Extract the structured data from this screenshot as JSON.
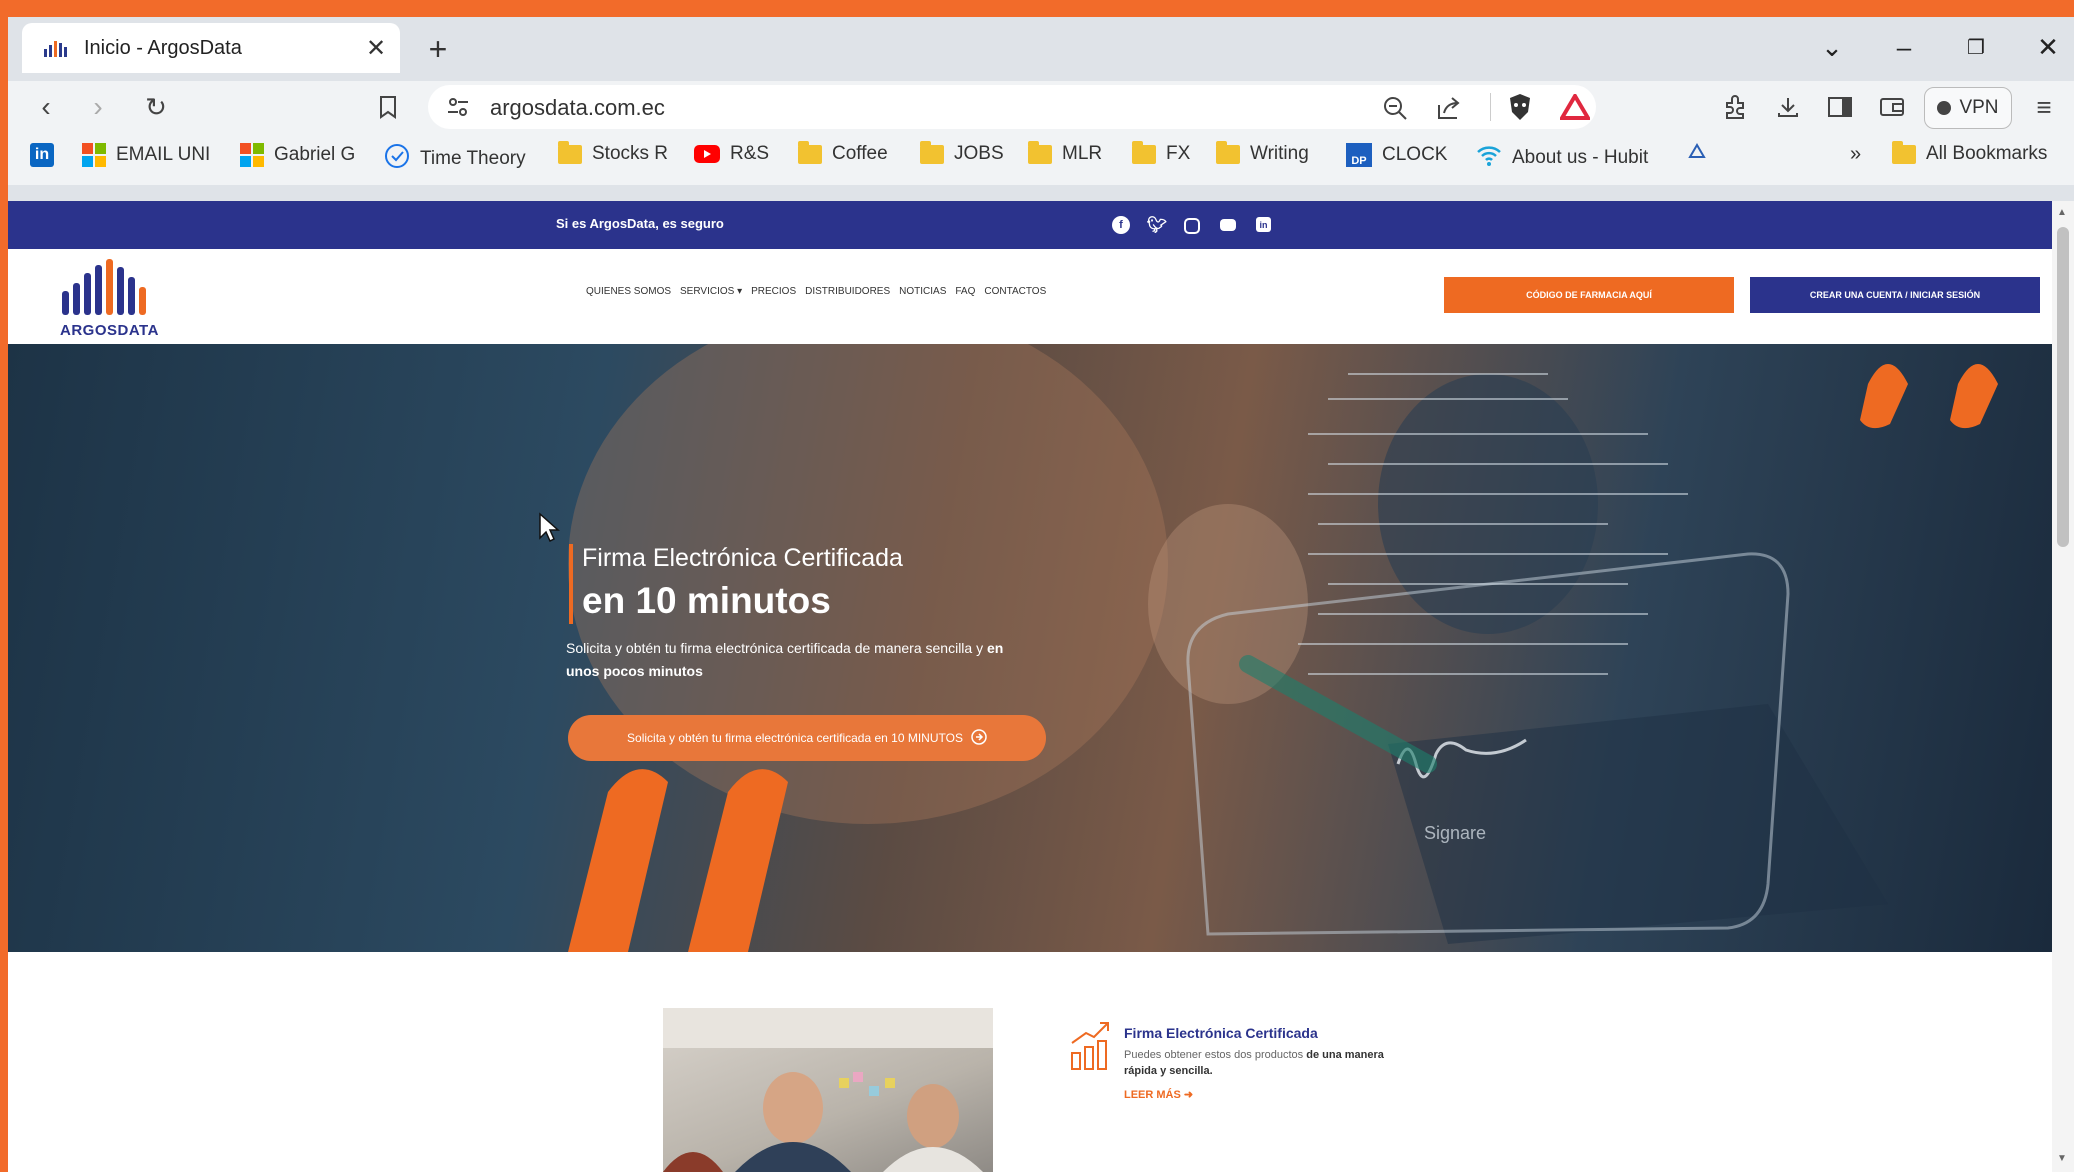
{
  "browser": {
    "tab_title": "Inicio - ArgosData",
    "url": "argosdata.com.ec",
    "vpn_label": "VPN"
  },
  "bookmarks": [
    {
      "label": "",
      "type": "linkedin"
    },
    {
      "label": "EMAIL UNI",
      "type": "ms"
    },
    {
      "label": "Gabriel G",
      "type": "ms"
    },
    {
      "label": "Time Theory",
      "type": "check"
    },
    {
      "label": "Stocks R",
      "type": "folder"
    },
    {
      "label": "R&S",
      "type": "youtube"
    },
    {
      "label": "Coffee",
      "type": "folder"
    },
    {
      "label": "JOBS",
      "type": "folder"
    },
    {
      "label": "MLR",
      "type": "folder"
    },
    {
      "label": "FX",
      "type": "folder"
    },
    {
      "label": "Writing",
      "type": "folder"
    },
    {
      "label": "CLOCK",
      "type": "dp"
    },
    {
      "label": "About us - Hubit",
      "type": "wifi"
    }
  ],
  "all_bookmarks": "All Bookmarks",
  "site": {
    "topbar_text": "Si es ArgosData, es seguro",
    "logo_text": "ARGOSDATA",
    "nav": [
      "QUIENES SOMOS",
      "SERVICIOS",
      "PRECIOS",
      "DISTRIBUIDORES",
      "NOTICIAS",
      "FAQ",
      "CONTACTOS"
    ],
    "btn_pharmacy": "CÓDIGO DE FARMACIA AQUÍ",
    "btn_account": "CREAR UNA CUENTA / INICIAR SESIÓN",
    "hero": {
      "title1": "Firma Electrónica Certificada",
      "title2": "en 10 minutos",
      "desc_pre": "Solicita y obtén tu firma electrónica certificada de manera sencilla y ",
      "desc_bold": "en unos pocos minutos",
      "cta": "Solicita y obtén tu firma electrónica certificada en 10 MINUTOS",
      "signature_text": "Signare"
    },
    "feature": {
      "title": "Firma Electrónica Certificada",
      "desc_pre": "Puedes obtener estos dos productos ",
      "desc_bold": "de una manera rápida y sencilla.",
      "link": "LEER MÁS"
    }
  },
  "colors": {
    "brand_navy": "#2b338c",
    "brand_orange": "#ee6a22",
    "frame_orange": "#f26b2a"
  }
}
